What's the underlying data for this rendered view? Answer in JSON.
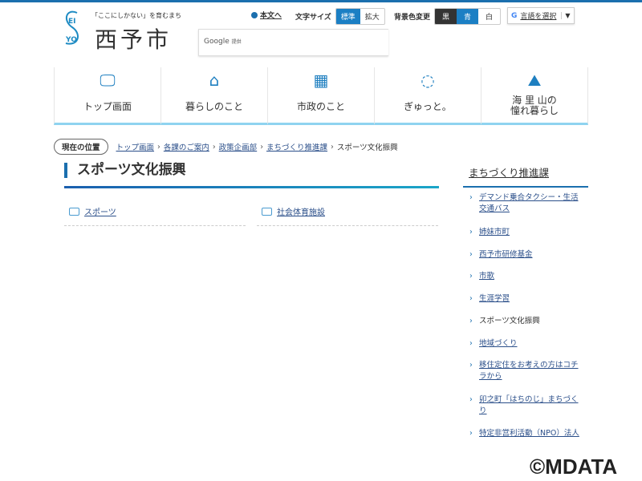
{
  "header": {
    "tagline": "「ここにしかない」を育むまち",
    "site_name": "西予市",
    "logo_letters": [
      "E",
      "I",
      "S",
      "Y",
      "O"
    ],
    "skip_link": "本文へ",
    "font_size_label": "文字サイズ",
    "font_sizes": [
      "標準",
      "拡大"
    ],
    "bg_label": "背景色変更",
    "bg_options": [
      "黒",
      "青",
      "白"
    ],
    "translate_label": "言語を選択",
    "translate_arrow": "▼",
    "search_provider": "Google",
    "search_provided": "提供"
  },
  "nav": [
    {
      "label": "トップ画面",
      "icon": "monitor-icon"
    },
    {
      "label": "暮らしのこと",
      "icon": "house-icon"
    },
    {
      "label": "市政のこと",
      "icon": "building-icon"
    },
    {
      "label": "ぎゅっと。",
      "icon": "mikan-icon"
    },
    {
      "label": "海 里 山の",
      "label2": "憧れ暮らし",
      "icon": "mountain-sea-icon"
    }
  ],
  "breadcrumb": {
    "here": "現在の位置",
    "items": [
      "トップ画面",
      "各課のご案内",
      "政策企画部",
      "まちづくり推進課"
    ],
    "current": "スポーツ文化振興"
  },
  "page_title": "スポーツ文化振興",
  "categories": [
    "スポーツ",
    "社会体育施設"
  ],
  "sidebar": {
    "title": "まちづくり推進課",
    "items": [
      {
        "label": "デマンド乗合タクシー・生活交通バス"
      },
      {
        "label": "姉妹市町"
      },
      {
        "label": "西予市研修基金"
      },
      {
        "label": "市歌"
      },
      {
        "label": "生涯学習"
      },
      {
        "label": "スポーツ文化振興",
        "current": true
      },
      {
        "label": "地域づくり"
      },
      {
        "label": "移住定住をお考えの方はコチラから"
      },
      {
        "label": "卯之町「はちのじ」まちづくり"
      },
      {
        "label": "特定非営利活動（NPO）法人"
      }
    ]
  },
  "watermark": "©MDATA"
}
